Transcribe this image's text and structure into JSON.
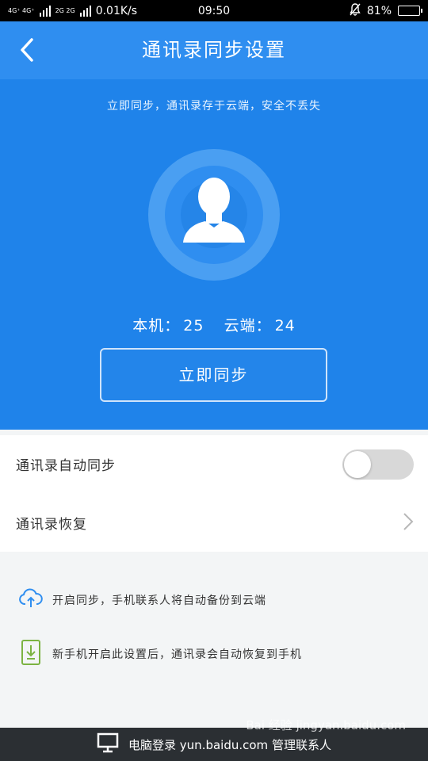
{
  "status_bar": {
    "network_1": "4G⁺ 4G⁺",
    "network_2": "2G 2G",
    "speed": "0.01K/s",
    "time": "09:50",
    "battery": "81%",
    "battery_level": 0.81
  },
  "header": {
    "title": "通讯录同步设置",
    "back_icon": "chevron-left-icon"
  },
  "hero": {
    "subtitle": "立即同步，通讯录存于云端，安全不丢失",
    "avatar_icon": "user-silhouette-icon",
    "local_label": "本机：",
    "local_count": "25",
    "cloud_label": "云端：",
    "cloud_count": "24",
    "sync_button": "立即同步"
  },
  "settings": {
    "auto_sync_label": "通讯录自动同步",
    "auto_sync_on": false,
    "restore_label": "通讯录恢复"
  },
  "info": {
    "items": [
      {
        "icon": "cloud-upload-icon",
        "text": "开启同步，手机联系人将自动备份到云端"
      },
      {
        "icon": "phone-download-icon",
        "text": "新手机开启此设置后，通讯录会自动恢复到手机"
      }
    ]
  },
  "footer": {
    "icon": "monitor-icon",
    "text": "电脑登录 yun.baidu.com 管理联系人"
  },
  "watermark": "Bai 经验 jingyan.baidu.com",
  "colors": {
    "title_bar": "#2f8ef0",
    "hero": "#1f83ea",
    "footer": "#2b2f33"
  }
}
